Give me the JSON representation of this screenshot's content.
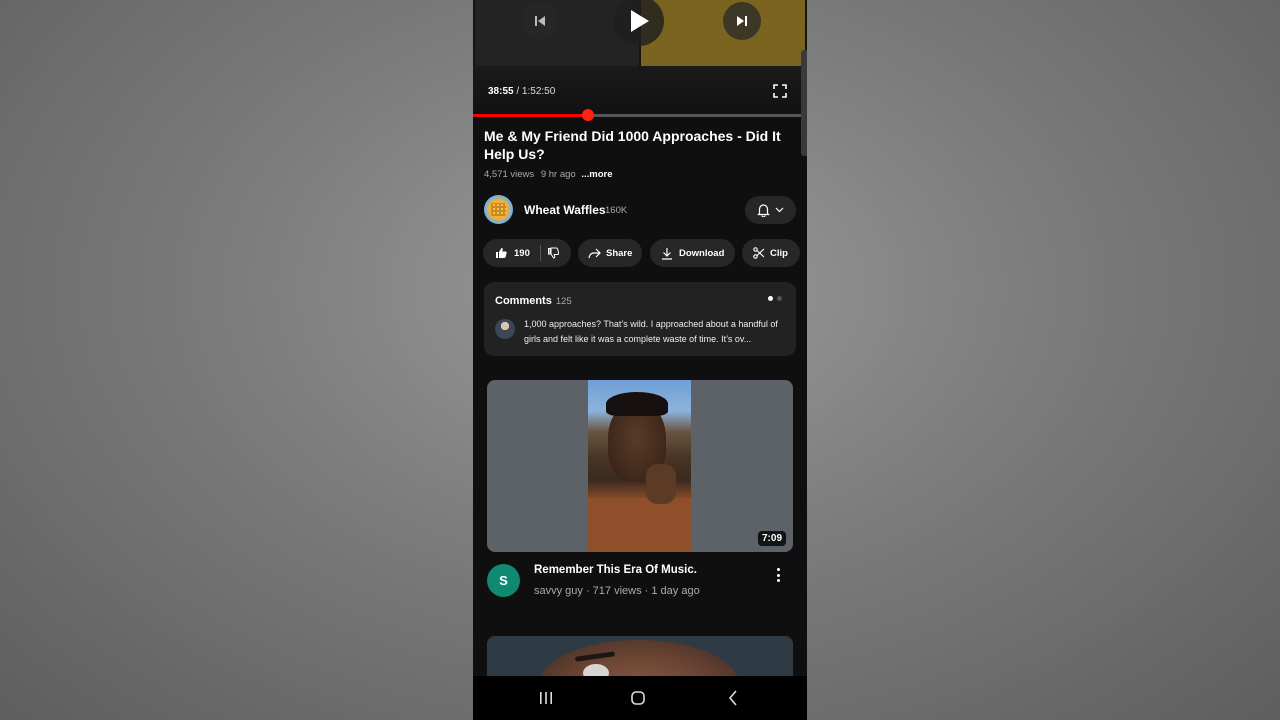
{
  "player": {
    "current_time": "38:55",
    "duration": " / 1:52:50",
    "progress_fraction": 0.344,
    "icons": [
      "previous-icon",
      "play-icon",
      "next-icon",
      "fullscreen-icon"
    ]
  },
  "video": {
    "title": "Me & My Friend Did 1000 Approaches - Did It Help Us?",
    "views": "4,571 views",
    "age": "9 hr ago",
    "more_label": "...more"
  },
  "channel": {
    "name": "Wheat Waffles",
    "subscribers": "160K"
  },
  "actions": {
    "like_count": "190",
    "share_label": "Share",
    "download_label": "Download",
    "clip_label": "Clip"
  },
  "comments": {
    "heading": "Comments",
    "count": "125",
    "top_comment": "1,000 approaches? That’s wild. I approached about a handful of girls and felt like it was a complete waste of time. It’s ov..."
  },
  "recommended": [
    {
      "title": "Remember This Era Of Music.",
      "avatar_letter": "S",
      "meta": "savvy guy · 717 views · 1 day ago",
      "duration": "7:09"
    }
  ],
  "colors": {
    "background": "#0f0f0f",
    "progress": "#ff0000",
    "chip": "#272727",
    "avatar_green": "#0f8a70"
  }
}
